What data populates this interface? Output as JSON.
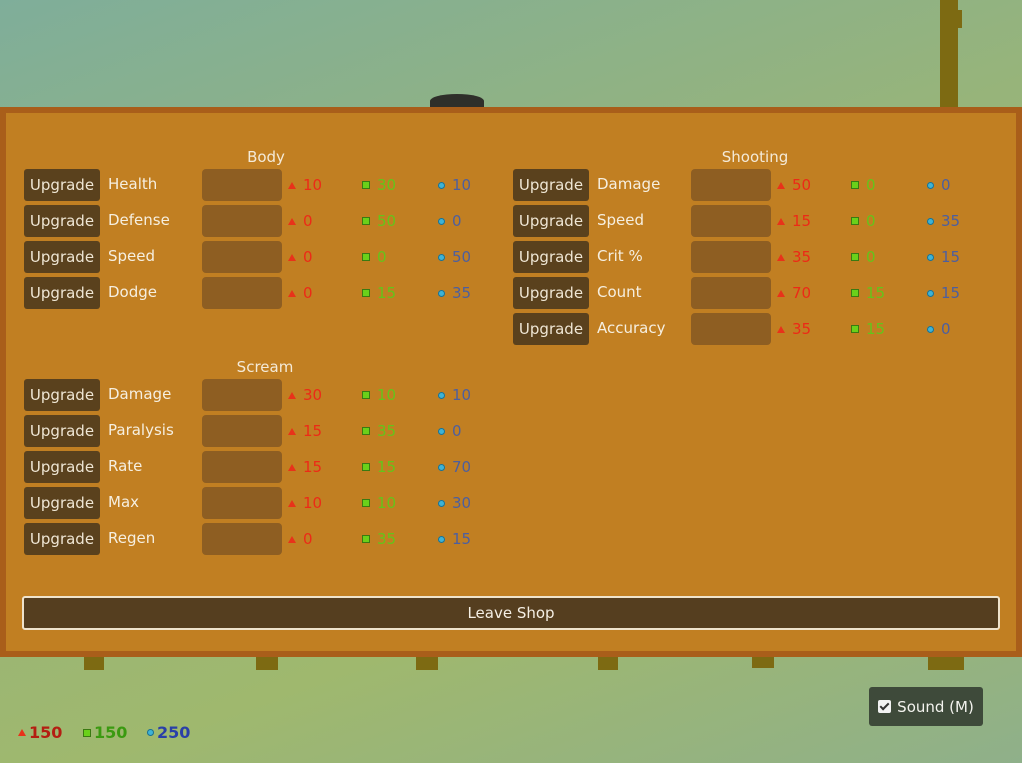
{
  "sections": {
    "body": {
      "title": "Body",
      "rows": [
        {
          "button": "Upgrade",
          "label": "Health",
          "red": "10",
          "green": "30",
          "blue": "10"
        },
        {
          "button": "Upgrade",
          "label": "Defense",
          "red": "0",
          "green": "50",
          "blue": "0"
        },
        {
          "button": "Upgrade",
          "label": "Speed",
          "red": "0",
          "green": "0",
          "blue": "50"
        },
        {
          "button": "Upgrade",
          "label": "Dodge",
          "red": "0",
          "green": "15",
          "blue": "35"
        }
      ]
    },
    "scream": {
      "title": "Scream",
      "rows": [
        {
          "button": "Upgrade",
          "label": "Damage",
          "red": "30",
          "green": "10",
          "blue": "10"
        },
        {
          "button": "Upgrade",
          "label": "Paralysis",
          "red": "15",
          "green": "35",
          "blue": "0"
        },
        {
          "button": "Upgrade",
          "label": "Rate",
          "red": "15",
          "green": "15",
          "blue": "70"
        },
        {
          "button": "Upgrade",
          "label": "Max",
          "red": "10",
          "green": "10",
          "blue": "30"
        },
        {
          "button": "Upgrade",
          "label": "Regen",
          "red": "0",
          "green": "35",
          "blue": "15"
        }
      ]
    },
    "shooting": {
      "title": "Shooting",
      "rows": [
        {
          "button": "Upgrade",
          "label": "Damage",
          "red": "50",
          "green": "0",
          "blue": "0"
        },
        {
          "button": "Upgrade",
          "label": "Speed",
          "red": "15",
          "green": "0",
          "blue": "35"
        },
        {
          "button": "Upgrade",
          "label": "Crit %",
          "red": "35",
          "green": "0",
          "blue": "15"
        },
        {
          "button": "Upgrade",
          "label": "Count",
          "red": "70",
          "green": "15",
          "blue": "15"
        },
        {
          "button": "Upgrade",
          "label": "Accuracy",
          "red": "35",
          "green": "15",
          "blue": "0"
        }
      ]
    }
  },
  "leave_label": "Leave Shop",
  "sound": {
    "label": "Sound (M)",
    "checked": true
  },
  "resources": {
    "red": "150",
    "green": "150",
    "blue": "250"
  },
  "colors": {
    "red": "#ec2a17",
    "green": "#65c41a",
    "blue": "#4c5fa0",
    "panel": "#c17f22",
    "button": "#5a411d"
  },
  "icons": {
    "red": "triangle-icon",
    "green": "square-icon",
    "blue": "star-icon"
  }
}
